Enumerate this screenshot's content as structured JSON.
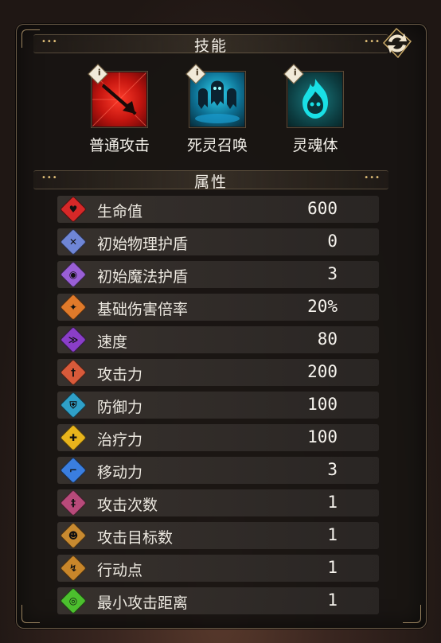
{
  "skills_header": {
    "title": "技能",
    "dots": "•••"
  },
  "attributes_header": {
    "title": "属性",
    "dots": "•••"
  },
  "swap_icon": "swap-arrows-icon",
  "info_badge": "i",
  "skills": [
    {
      "label": "普通攻击",
      "icon": "sword-strike-icon",
      "color": "#c8201c"
    },
    {
      "label": "死灵召唤",
      "icon": "ghost-summon-icon",
      "color": "#1fa9c8"
    },
    {
      "label": "灵魂体",
      "icon": "soul-flame-icon",
      "color": "#1bbcc0"
    }
  ],
  "stats": [
    {
      "name": "生命值",
      "value": "600",
      "icon": "heart-icon",
      "color": "#d62828"
    },
    {
      "name": "初始物理护盾",
      "value": "0",
      "icon": "physical-shield-icon",
      "color": "#6f86d6"
    },
    {
      "name": "初始魔法护盾",
      "value": "3",
      "icon": "magic-shield-icon",
      "color": "#9a5fd6"
    },
    {
      "name": "基础伤害倍率",
      "value": "20%",
      "icon": "damage-multiplier-icon",
      "color": "#e07a2a"
    },
    {
      "name": "速度",
      "value": "80",
      "icon": "speed-icon",
      "color": "#8a3ec8"
    },
    {
      "name": "攻击力",
      "value": "200",
      "icon": "attack-icon",
      "color": "#d85a3a"
    },
    {
      "name": "防御力",
      "value": "100",
      "icon": "defense-icon",
      "color": "#2fa0c8"
    },
    {
      "name": "治疗力",
      "value": "100",
      "icon": "heal-icon",
      "color": "#e8b41c"
    },
    {
      "name": "移动力",
      "value": "3",
      "icon": "boot-icon",
      "color": "#3a7ee0"
    },
    {
      "name": "攻击次数",
      "value": "1",
      "icon": "attack-count-icon",
      "color": "#b84a7a"
    },
    {
      "name": "攻击目标数",
      "value": "1",
      "icon": "target-count-icon",
      "color": "#c88a30"
    },
    {
      "name": "行动点",
      "value": "1",
      "icon": "action-point-icon",
      "color": "#c8862a"
    },
    {
      "name": "最小攻击距离",
      "value": "1",
      "icon": "range-icon",
      "color": "#4cbf2e"
    }
  ]
}
